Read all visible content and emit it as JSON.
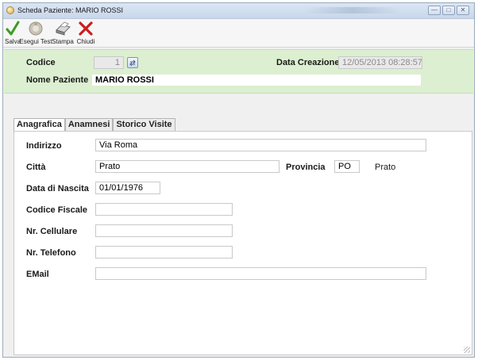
{
  "window": {
    "title": "Scheda Paziente: MARIO ROSSI",
    "controls": [
      "minimize",
      "maximize",
      "close"
    ]
  },
  "toolbar": {
    "save_label": "Salva",
    "tests_label": "Esegui Test",
    "print_label": "Stampa",
    "close_label": "Chiudi"
  },
  "header": {
    "codice_label": "Codice",
    "codice_value": "1",
    "data_creazione_label": "Data Creazione",
    "data_creazione_value": "12/05/2013 08:28:57",
    "nome_label": "Nome Paziente",
    "nome_value": "MARIO ROSSI"
  },
  "tabs": [
    {
      "label": "Anagrafica",
      "active": true
    },
    {
      "label": "Anamnesi",
      "active": false
    },
    {
      "label": "Storico Visite",
      "active": false
    }
  ],
  "anagrafica": {
    "indirizzo_label": "Indirizzo",
    "indirizzo_value": "Via Roma",
    "citta_label": "Città",
    "citta_value": "Prato",
    "provincia_label": "Provincia",
    "provincia_value": "PO",
    "provincia_name": "Prato",
    "nascita_label": "Data di Nascita",
    "nascita_value": "01/01/1976",
    "cf_label": "Codice Fiscale",
    "cf_value": "",
    "cellulare_label": "Nr. Cellulare",
    "cellulare_value": "",
    "telefono_label": "Nr. Telefono",
    "telefono_value": "",
    "email_label": "EMail",
    "email_value": ""
  },
  "colors": {
    "header_panel": "#dcefd0",
    "save_check": "#3a9d1f",
    "close_x": "#c81e1e"
  }
}
